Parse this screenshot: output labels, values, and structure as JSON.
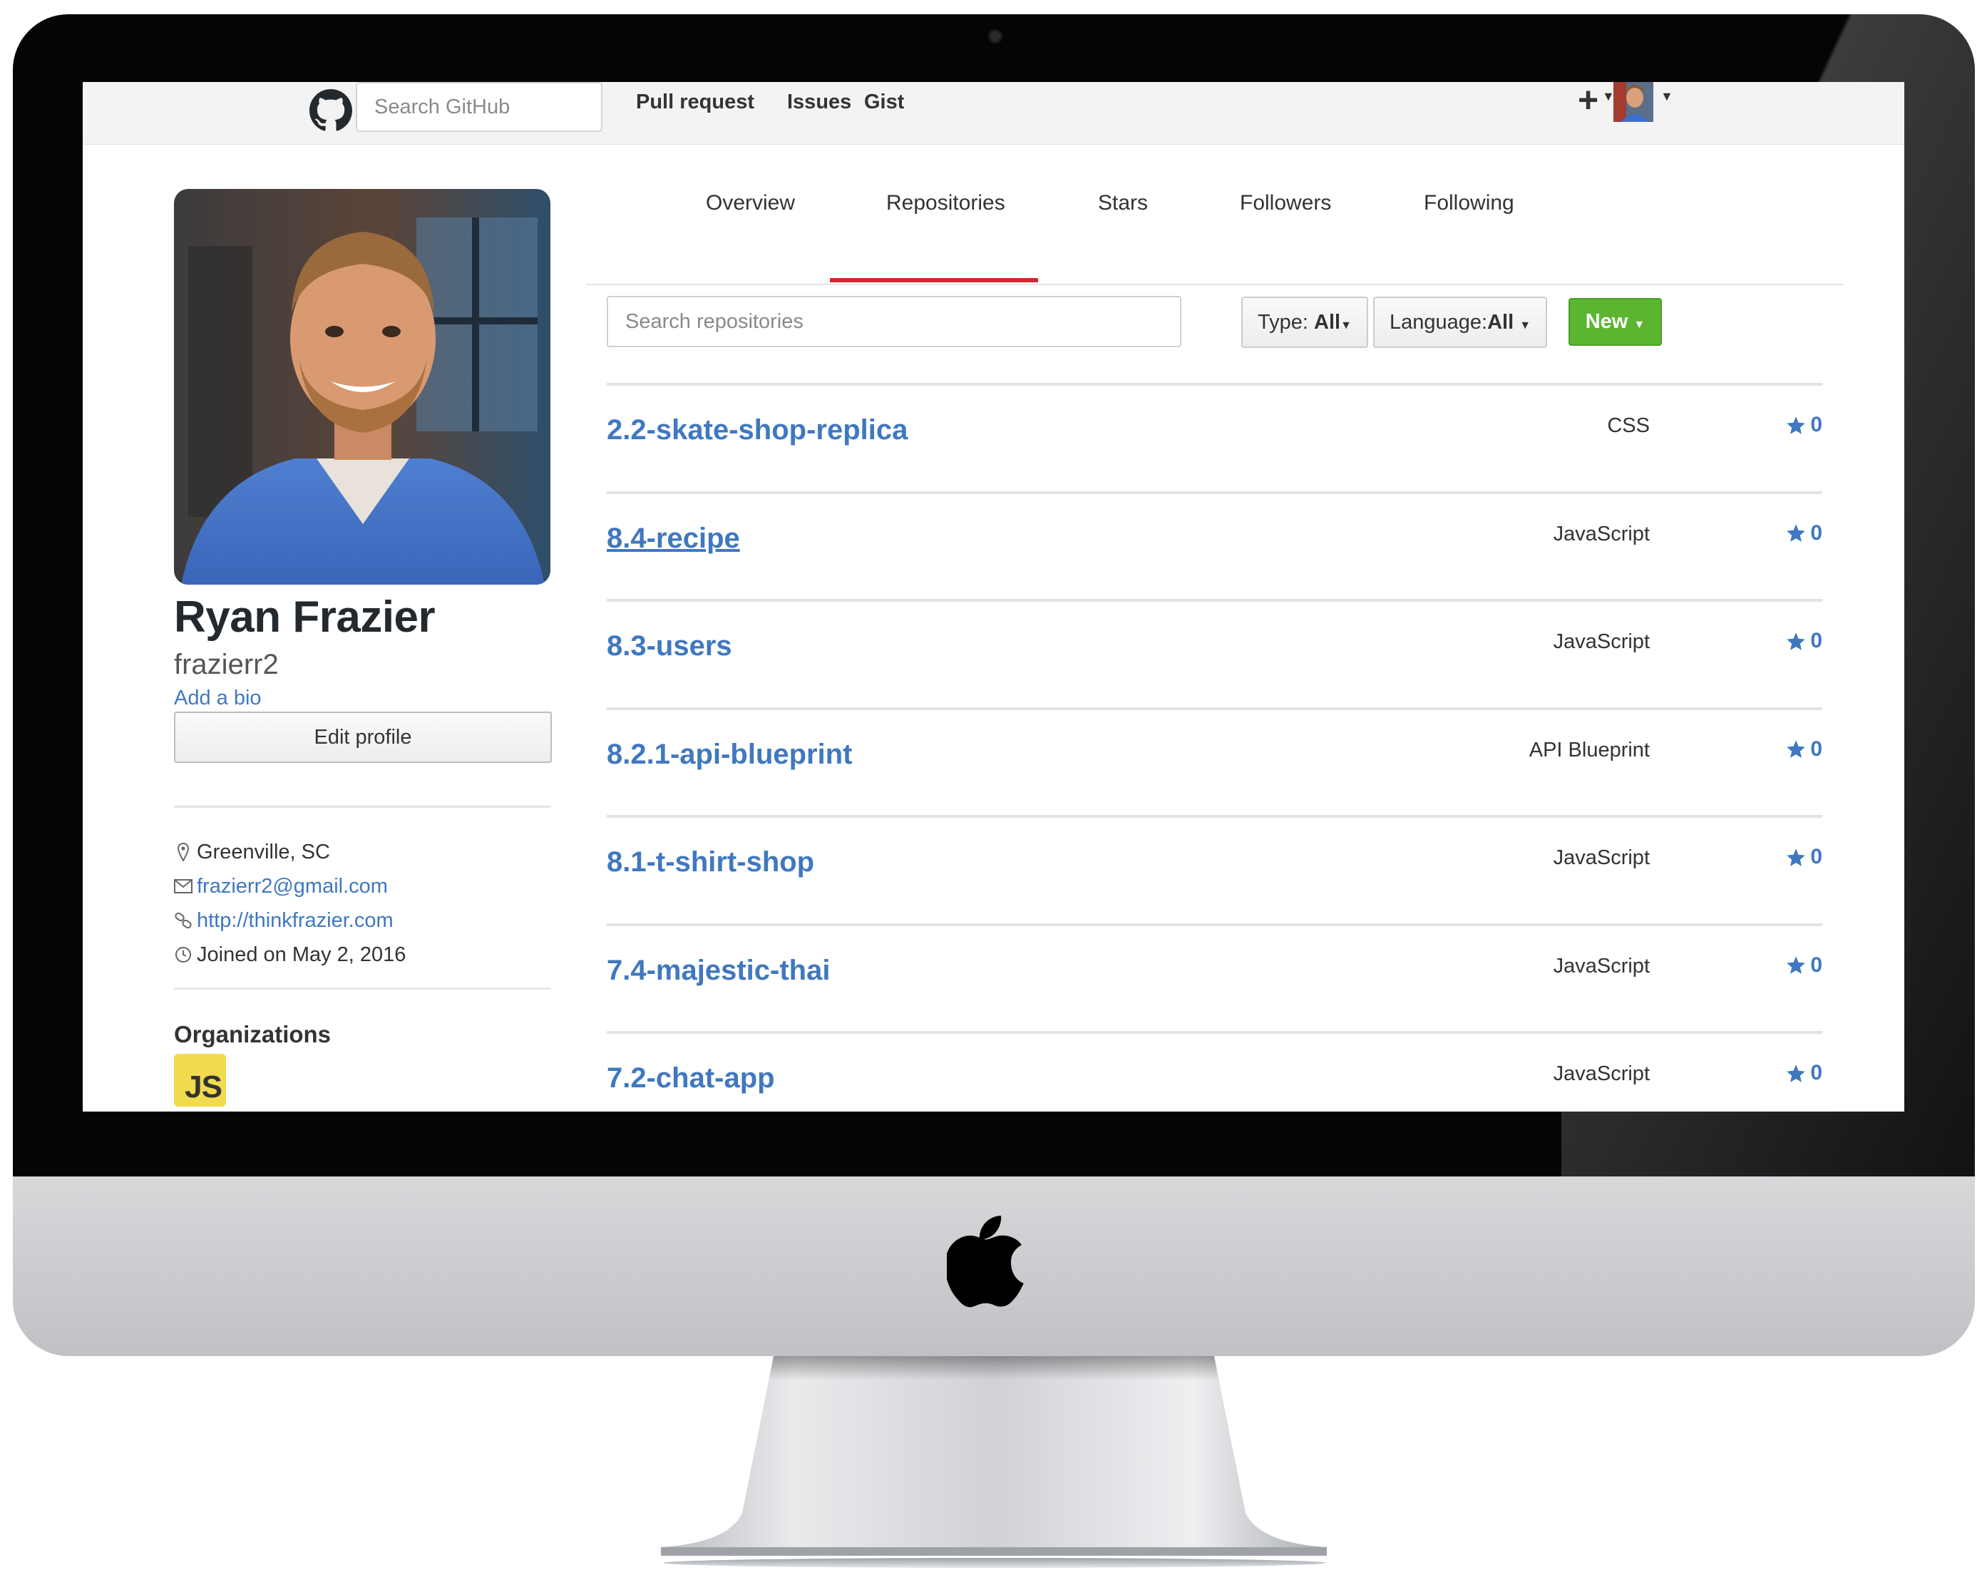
{
  "header": {
    "search_placeholder": "Search GitHub",
    "nav": [
      "Pull request",
      "Issues",
      "Gist"
    ],
    "plus_label": "+"
  },
  "profile": {
    "full_name": "Ryan Frazier",
    "username": "frazierr2",
    "add_bio": "Add a bio",
    "edit_profile": "Edit profile",
    "location": "Greenville, SC",
    "email": "frazierr2@gmail.com",
    "website": "http://thinkfrazier.com",
    "joined": "Joined on May 2, 2016",
    "organizations_title": "Organizations",
    "org_badge": "JS"
  },
  "tabs": [
    "Overview",
    "Repositories",
    "Stars",
    "Followers",
    "Following"
  ],
  "active_tab": "Repositories",
  "filters": {
    "search_placeholder": "Search repositories",
    "type_label": "Type: ",
    "type_value": "All",
    "language_label": "Language:",
    "language_value": "All",
    "new_label": "New"
  },
  "repos": [
    {
      "name": "2.2-skate-shop-replica",
      "language": "CSS",
      "stars": "0"
    },
    {
      "name": "8.4-recipe",
      "language": "JavaScript",
      "stars": "0"
    },
    {
      "name": "8.3-users",
      "language": "JavaScript",
      "stars": "0"
    },
    {
      "name": "8.2.1-api-blueprint",
      "language": "API Blueprint",
      "stars": "0"
    },
    {
      "name": "8.1-t-shirt-shop",
      "language": "JavaScript",
      "stars": "0"
    },
    {
      "name": "7.4-majestic-thai",
      "language": "JavaScript",
      "stars": "0"
    },
    {
      "name": "7.2-chat-app",
      "language": "JavaScript",
      "stars": "0"
    }
  ],
  "colors": {
    "link_blue": "#4078c0",
    "active_tab_red": "#d0282e",
    "new_button_green": "#5cb531",
    "org_js_yellow": "#f0db4f"
  },
  "icons": {
    "logo": "github-octocat-icon",
    "plus": "plus-icon",
    "location": "location-pin-icon",
    "email": "mail-icon",
    "website": "link-icon",
    "joined": "clock-icon",
    "star": "star-icon",
    "device": "apple-logo-icon"
  }
}
